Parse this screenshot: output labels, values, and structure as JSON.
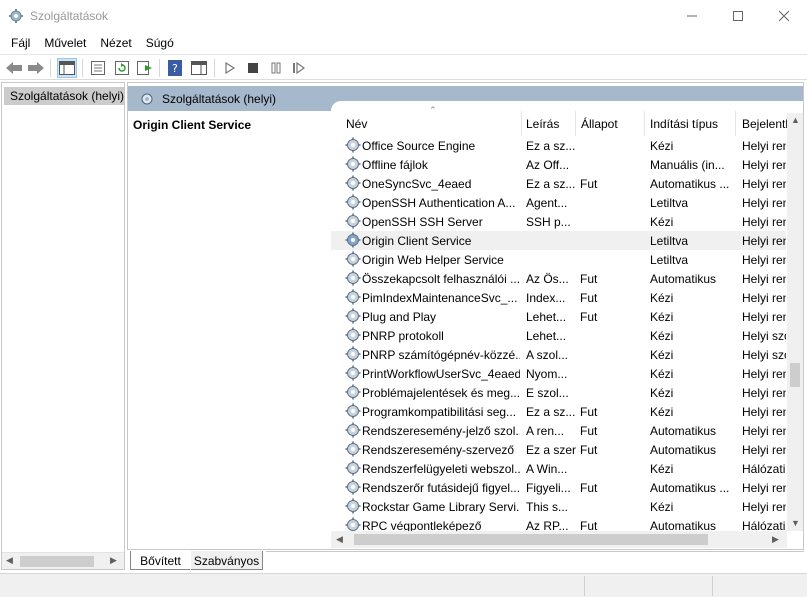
{
  "window": {
    "title": "Szolgáltatások"
  },
  "menu": [
    "Fájl",
    "Művelet",
    "Nézet",
    "Súgó"
  ],
  "tree": {
    "root_label": "Szolgáltatások (helyi)"
  },
  "panel": {
    "header": "Szolgáltatások (helyi)",
    "selected_service": "Origin Client Service"
  },
  "columns": {
    "name": "Név",
    "description": "Leírás",
    "status": "Állapot",
    "startup": "Indítási típus",
    "logon": "Bejelentkezés mint"
  },
  "services": [
    {
      "name": "Office Source Engine",
      "desc": "Ez a sz...",
      "status": "",
      "startup": "Kézi",
      "logon": "Helyi rendszer"
    },
    {
      "name": "Offline fájlok",
      "desc": "Az Off...",
      "status": "",
      "startup": "Manuális (in...",
      "logon": "Helyi rendszer"
    },
    {
      "name": "OneSyncSvc_4eaed",
      "desc": "Ez a sz...",
      "status": "Fut",
      "startup": "Automatikus ...",
      "logon": "Helyi rendszer"
    },
    {
      "name": "OpenSSH Authentication A...",
      "desc": "Agent...",
      "status": "",
      "startup": "Letiltva",
      "logon": "Helyi rendszer"
    },
    {
      "name": "OpenSSH SSH Server",
      "desc": "SSH p...",
      "status": "",
      "startup": "Kézi",
      "logon": "Helyi rendszer"
    },
    {
      "name": "Origin Client Service",
      "desc": "",
      "status": "",
      "startup": "Letiltva",
      "logon": "Helyi rendszer",
      "selected": true
    },
    {
      "name": "Origin Web Helper Service",
      "desc": "",
      "status": "",
      "startup": "Letiltva",
      "logon": "Helyi rendszer"
    },
    {
      "name": "Összekapcsolt felhasználói ...",
      "desc": "Az Ös...",
      "status": "Fut",
      "startup": "Automatikus",
      "logon": "Helyi rendszer"
    },
    {
      "name": "PimIndexMaintenanceSvc_...",
      "desc": "Index...",
      "status": "Fut",
      "startup": "Kézi",
      "logon": "Helyi rendszer"
    },
    {
      "name": "Plug and Play",
      "desc": "Lehet...",
      "status": "Fut",
      "startup": "Kézi",
      "logon": "Helyi rendszer"
    },
    {
      "name": "PNRP protokoll",
      "desc": "Lehet...",
      "status": "",
      "startup": "Kézi",
      "logon": "Helyi szolgáltatás"
    },
    {
      "name": "PNRP számítógépnév-közzé...",
      "desc": "A szol...",
      "status": "",
      "startup": "Kézi",
      "logon": "Helyi szolgáltatás"
    },
    {
      "name": "PrintWorkflowUserSvc_4eaed",
      "desc": "Nyom...",
      "status": "",
      "startup": "Kézi",
      "logon": "Helyi rendszer"
    },
    {
      "name": "Problémajelentések és meg...",
      "desc": "E szol...",
      "status": "",
      "startup": "Kézi",
      "logon": "Helyi rendszer"
    },
    {
      "name": "Programkompatibilitási seg...",
      "desc": "Ez a sz...",
      "status": "Fut",
      "startup": "Kézi",
      "logon": "Helyi rendszer"
    },
    {
      "name": "Rendszeresemény-jelző szol...",
      "desc": "A ren...",
      "status": "Fut",
      "startup": "Automatikus",
      "logon": "Helyi rendszer"
    },
    {
      "name": "Rendszeresemény-szervező",
      "desc": "Ez a szerv...",
      "status": "Fut",
      "startup": "Automatikus",
      "logon": "Helyi rendszer"
    },
    {
      "name": "Rendszerfelügyeleti webszol...",
      "desc": "A Win...",
      "status": "",
      "startup": "Kézi",
      "logon": "Hálózati szolgáltatás"
    },
    {
      "name": "Rendszerőr futásidejű figyel...",
      "desc": "Figyeli...",
      "status": "Fut",
      "startup": "Automatikus ...",
      "logon": "Helyi rendszer"
    },
    {
      "name": "Rockstar Game Library Servi...",
      "desc": "This s...",
      "status": "",
      "startup": "Kézi",
      "logon": "Helyi rendszer"
    },
    {
      "name": "RPC végpontleképező",
      "desc": "Az RP...",
      "status": "Fut",
      "startup": "Automatikus",
      "logon": "Hálózati szolgáltatás"
    }
  ],
  "tabs": {
    "extended": "Bővített",
    "standard": "Szabványos"
  },
  "colors": {
    "header_bg": "#a6b8cc",
    "selected_row": "#f0f0f0",
    "tree_selected": "#cccccc"
  }
}
